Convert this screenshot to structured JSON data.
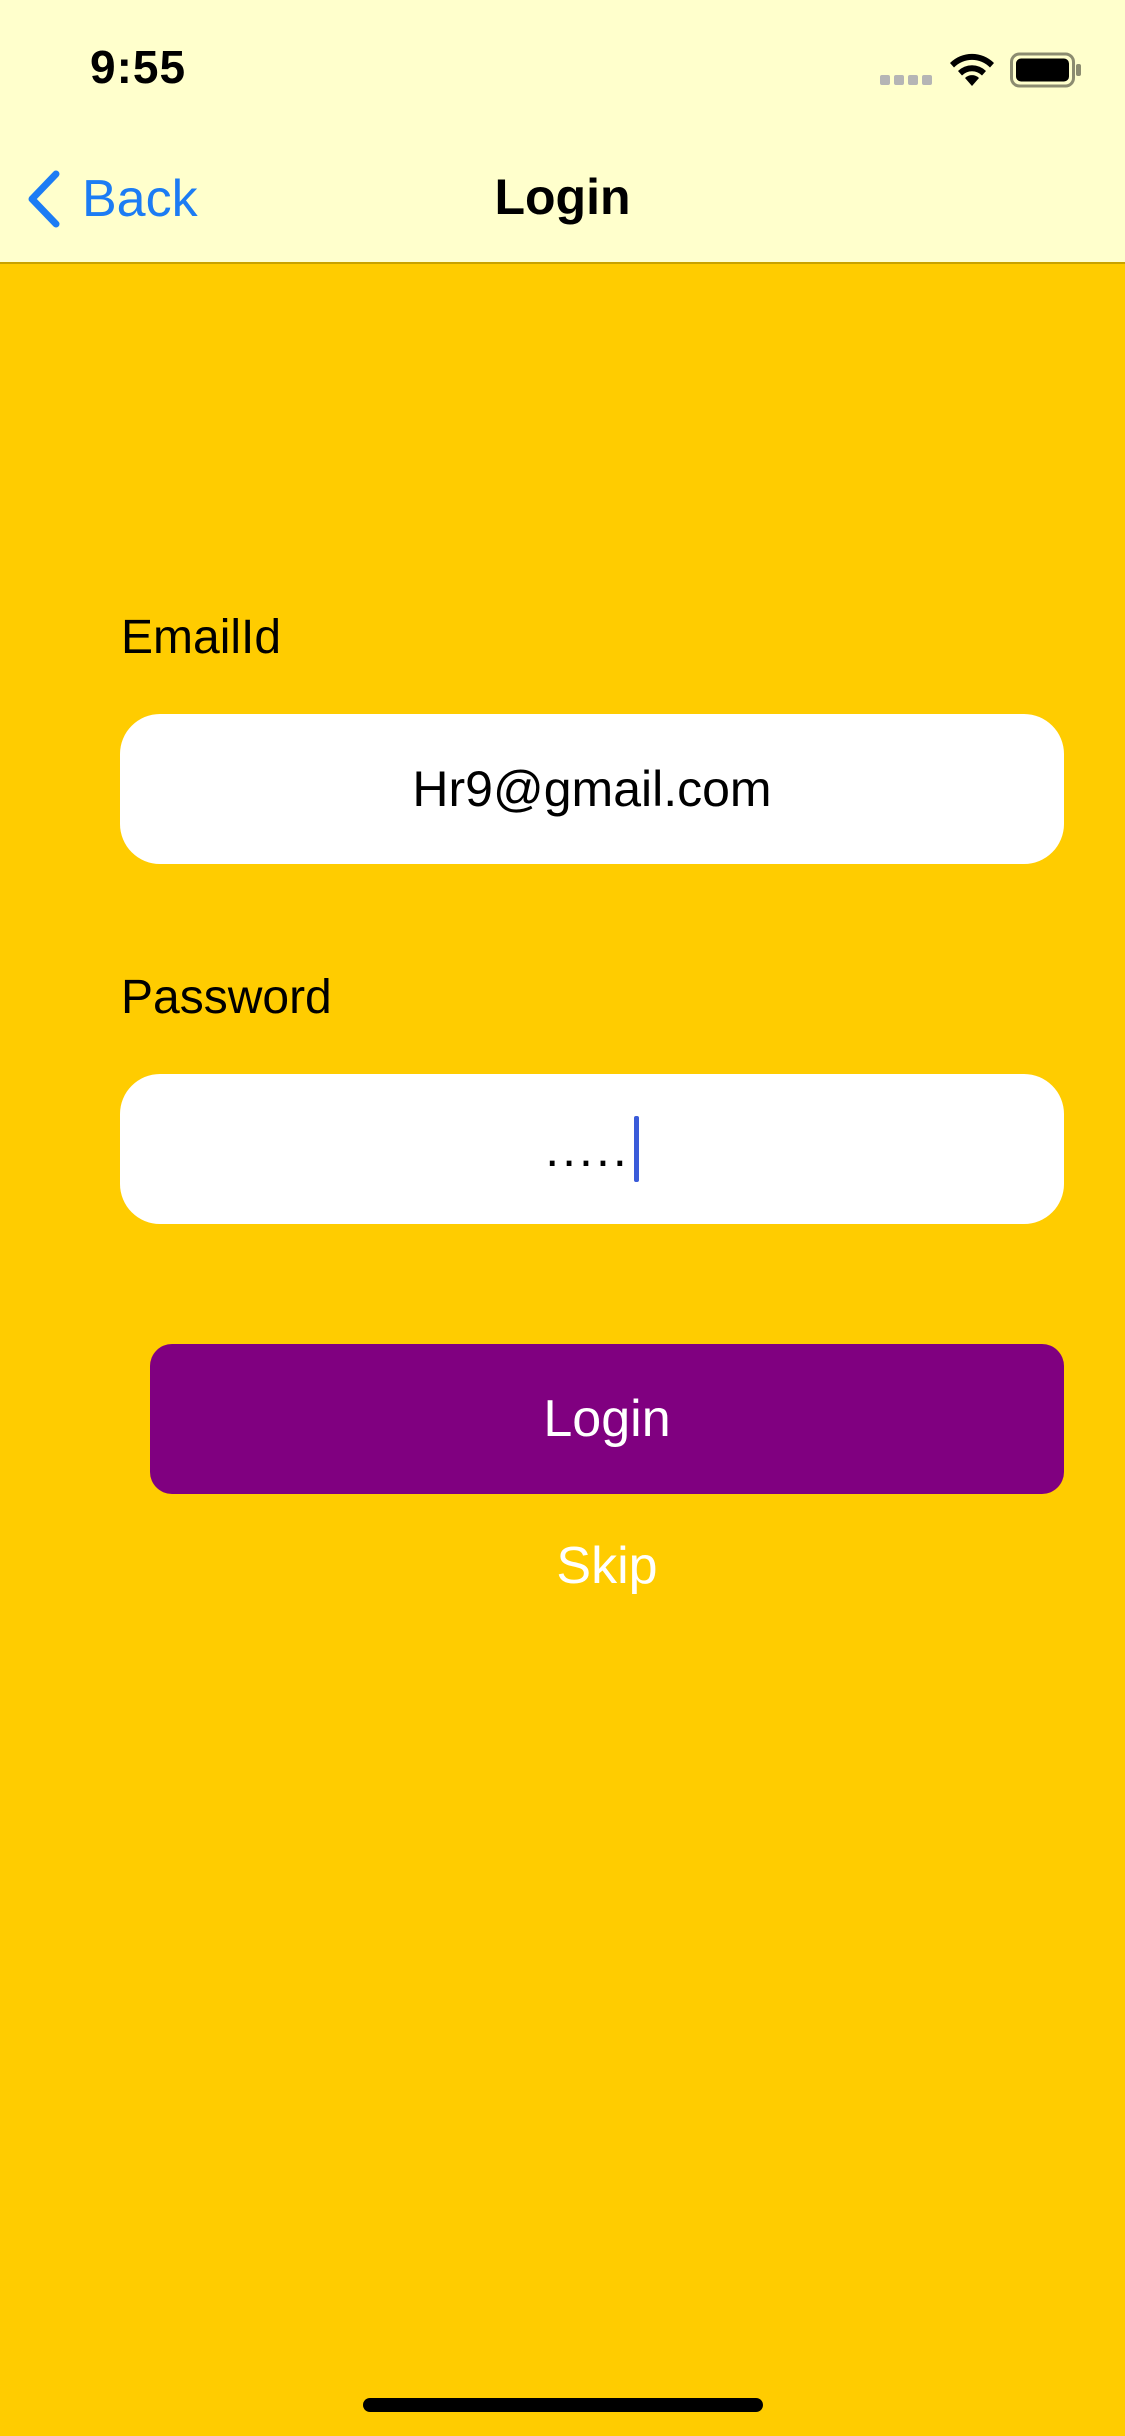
{
  "status_bar": {
    "time": "9:55",
    "signal_icon": "cellular-signal-icon",
    "wifi_icon": "wifi-icon",
    "battery_icon": "battery-icon"
  },
  "nav": {
    "back_label": "Back",
    "back_icon": "chevron-left-icon",
    "title": "Login"
  },
  "form": {
    "email_label": "EmailId",
    "email_value": "Hr9@gmail.com",
    "password_label": "Password",
    "password_value": ".....",
    "login_label": "Login",
    "skip_label": "Skip"
  },
  "colors": {
    "background": "#FFCC00",
    "nav_background": "#FFFFCC",
    "accent": "#1C7CF4",
    "login_button": "#800080",
    "field_background": "#FFFFFF"
  }
}
